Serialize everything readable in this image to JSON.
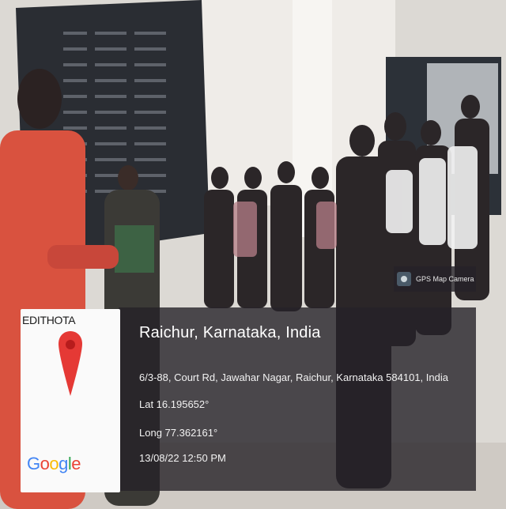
{
  "overlay": {
    "city": "Raichur, Karnataka, India",
    "address": "6/3-88, Court Rd, Jawahar Nagar, Raichur, Karnataka 584101, India",
    "lat": "Lat 16.195652°",
    "long": "Long 77.362161°",
    "datetime": "13/08/22 12:50 PM"
  },
  "gps_tag": {
    "label": "GPS Map Camera",
    "icon": "camera-icon"
  },
  "map_card": {
    "name": "EDITHOTA",
    "pin_icon": "map-pin-icon",
    "logo": "Google"
  },
  "colors": {
    "overlay_bg": "#262228",
    "pin_red": "#e53935",
    "board_dark": "#2a2d33",
    "shirt_red": "#d9523f"
  }
}
